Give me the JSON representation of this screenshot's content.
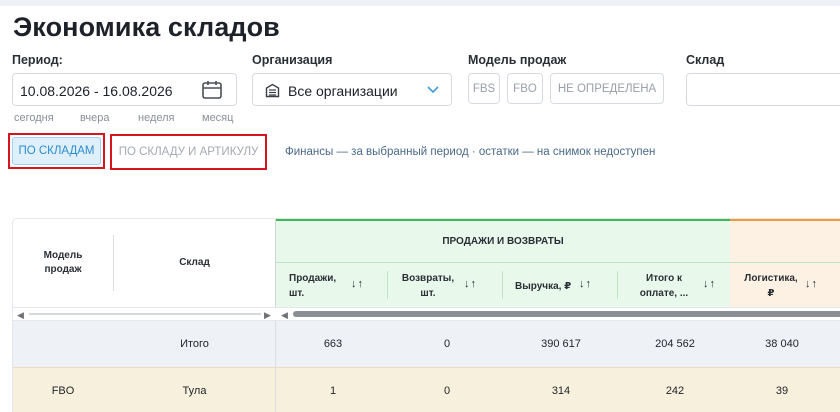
{
  "page": {
    "title": "Экономика складов"
  },
  "filters": {
    "period": {
      "label": "Период:",
      "value": "10.08.2026 - 16.08.2026",
      "quick_links": [
        "сегодня",
        "вчера",
        "неделя",
        "месяц"
      ]
    },
    "organization": {
      "label": "Организация",
      "value": "Все организации"
    },
    "sales_model": {
      "label": "Модель продаж",
      "chips": [
        "FBS",
        "FBO",
        "НЕ ОПРЕДЕЛЕНА"
      ]
    },
    "warehouse": {
      "label": "Склад",
      "value": ""
    }
  },
  "tabs": {
    "items": [
      {
        "label": "ПО СКЛАДАМ",
        "active": true
      },
      {
        "label": "ПО СКЛАДУ И АРТИКУЛУ",
        "active": false
      }
    ],
    "note": "Финансы — за выбранный период · остатки — на снимок недоступен"
  },
  "table": {
    "fixed_headers": {
      "model": "Модель продаж",
      "warehouse": "Склад"
    },
    "groups": {
      "sales": {
        "title": "ПРОДАЖИ И ВОЗВРАТЫ",
        "columns": [
          "Продажи, шт.",
          "Возвраты, шт.",
          "Выручка, ₽",
          "Итого к оплате, ..."
        ]
      },
      "logistics": {
        "columns": [
          "Логистика, ₽"
        ]
      }
    },
    "sort_glyph": "↓↑",
    "rows": [
      {
        "model": "",
        "warehouse": "Итого",
        "values": [
          "663",
          "0",
          "390 617",
          "204 562",
          "38 040"
        ]
      },
      {
        "model": "FBO",
        "warehouse": "Тула",
        "values": [
          "1",
          "0",
          "314",
          "242",
          "39"
        ]
      }
    ]
  },
  "colors": {
    "accent_blue": "#2d8ccf",
    "highlight_red": "#d8141c",
    "group_green": "#3cb957",
    "group_orange": "#f09a3e"
  }
}
